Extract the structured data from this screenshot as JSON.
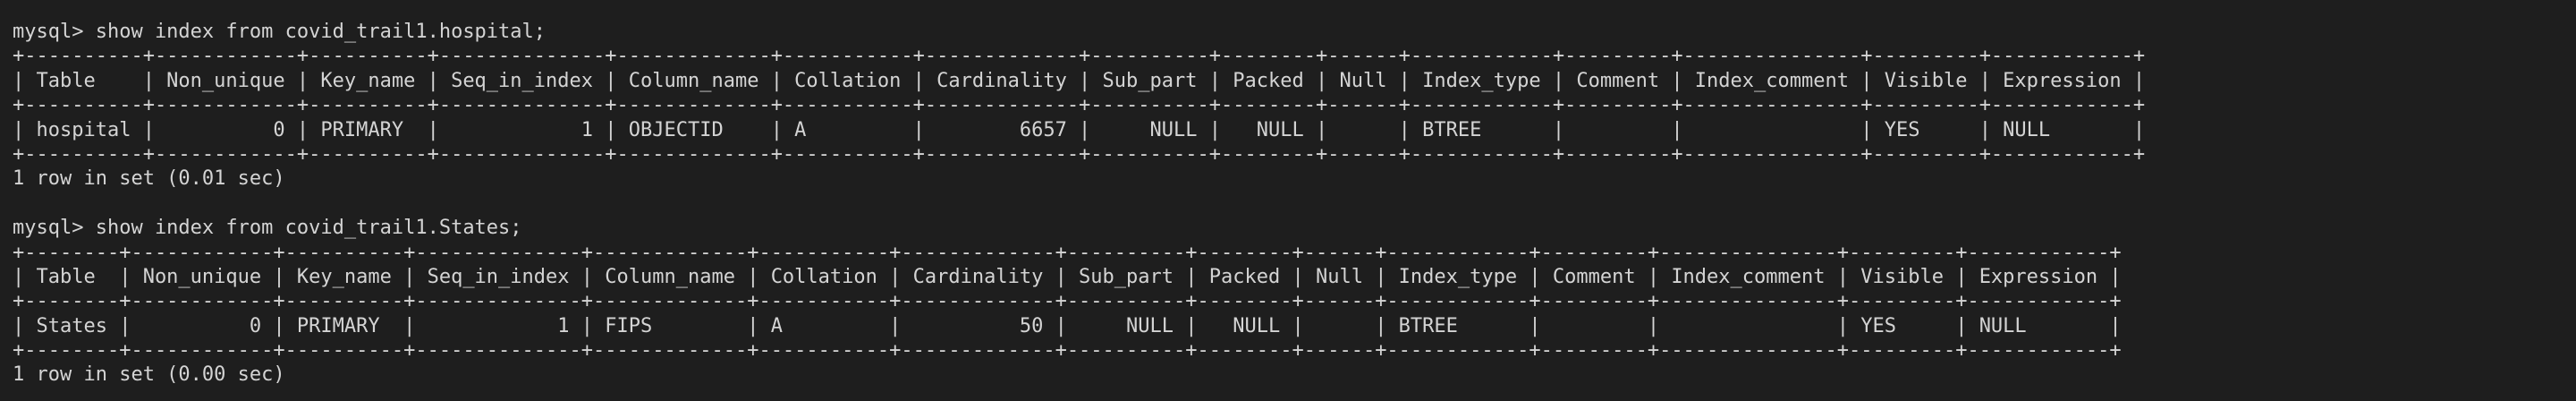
{
  "terminal": {
    "lines": [
      "mysql> show index from covid_trail1.hospital;",
      "+----------+------------+----------+--------------+-------------+-----------+-------------+----------+--------+------+------------+---------+---------------+---------+------------+",
      "| Table    | Non_unique | Key_name | Seq_in_index | Column_name | Collation | Cardinality | Sub_part | Packed | Null | Index_type | Comment | Index_comment | Visible | Expression |",
      "+----------+------------+----------+--------------+-------------+-----------+-------------+----------+--------+------+------------+---------+---------------+---------+------------+",
      "| hospital |          0 | PRIMARY  |            1 | OBJECTID    | A         |        6657 |     NULL |   NULL |      | BTREE      |         |               | YES     | NULL       |",
      "+----------+------------+----------+--------------+-------------+-----------+-------------+----------+--------+------+------------+---------+---------------+---------+------------+",
      "1 row in set (0.01 sec)",
      "",
      "mysql> show index from covid_trail1.States;",
      "+--------+------------+----------+--------------+-------------+-----------+-------------+----------+--------+------+------------+---------+---------------+---------+------------+",
      "| Table  | Non_unique | Key_name | Seq_in_index | Column_name | Collation | Cardinality | Sub_part | Packed | Null | Index_type | Comment | Index_comment | Visible | Expression |",
      "+--------+------------+----------+--------------+-------------+-----------+-------------+----------+--------+------+------------+---------+---------------+---------+------------+",
      "| States |          0 | PRIMARY  |            1 | FIPS        | A         |          50 |     NULL |   NULL |      | BTREE      |         |               | YES     | NULL       |",
      "+--------+------------+----------+--------------+-------------+-----------+-------------+----------+--------+------+------------+---------+---------------+---------+------------+",
      "1 row in set (0.00 sec)"
    ]
  }
}
